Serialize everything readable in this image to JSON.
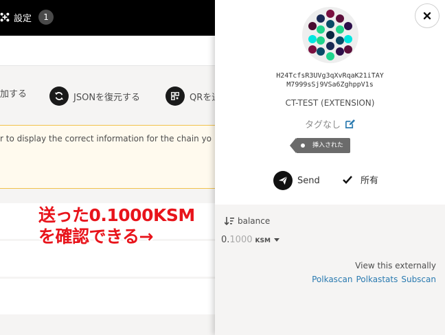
{
  "topbar": {
    "settings_label": "設定",
    "badge_count": "1"
  },
  "actions": {
    "add_label": "加する",
    "restore_json_label": "JSONを復元する",
    "qr_label": "QRを追"
  },
  "warning": {
    "text": "r to display the correct information for the chain yo"
  },
  "annotation": {
    "line1": "送った0.1000KSM",
    "line2": "を確認できる→"
  },
  "sidebar": {
    "address_line1": "H24TcfsR3UVg3qXvRqaK21iTAY",
    "address_line2": "M7999sSj9VSa6ZghppV1s",
    "account_name": "CT-TEST (EXTENSION)",
    "tags_label": "タグなし",
    "injected_label": "挿入された",
    "send_label": "Send",
    "owned_label": "所有",
    "balance_label": "balance",
    "balance_whole": "0.",
    "balance_frac": "1000",
    "balance_unit": "KSM",
    "external_label": "View this externally",
    "links": [
      "Polkascan",
      "Polkastats",
      "Subscan"
    ]
  },
  "colors": {
    "annotation": "#e8141b",
    "link": "#2a7ab0",
    "warning_border": "#f0c14b"
  }
}
